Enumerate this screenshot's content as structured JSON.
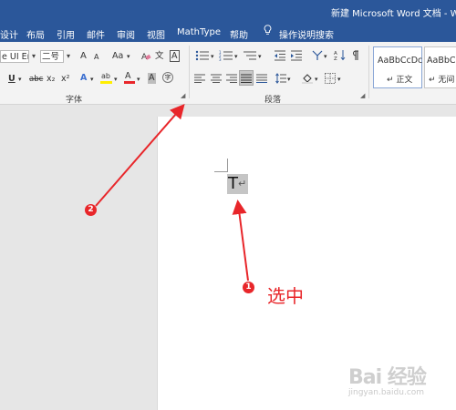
{
  "window": {
    "title": "新建 Microsoft Word 文档 - Wo"
  },
  "menu": {
    "tabs": [
      "设计",
      "布局",
      "引用",
      "邮件",
      "审阅",
      "视图",
      "MathType",
      "帮助"
    ],
    "tell_me": "操作说明搜索"
  },
  "ribbon": {
    "font_group": {
      "label": "字体",
      "font_name": "e UI Em",
      "font_size": "二号",
      "grow": "A",
      "shrink": "A",
      "change_case": "Aa",
      "underline": "U",
      "strikethrough": "abc",
      "subscript": "x₂",
      "superscript": "x²",
      "text_effects": "A",
      "highlight": "ab",
      "font_color": "A",
      "char_shading": "A",
      "enclose": "字",
      "phonetic": "文",
      "border_char": "A"
    },
    "paragraph_group": {
      "label": "段落"
    },
    "styles_group": {
      "styles": [
        {
          "sample": "AaBbCcDc",
          "name": "↵ 正文"
        },
        {
          "sample": "AaBbCc",
          "name": "↵ 无间"
        }
      ]
    }
  },
  "document": {
    "selected_text": "T",
    "paragraph_mark": "↵"
  },
  "annotations": {
    "badge1": "1",
    "badge2": "2",
    "select_label": "选中",
    "arrow_color": "#e8262a"
  },
  "watermark": {
    "text": "Bai 经验",
    "url": "jingyan.baidu.com"
  }
}
